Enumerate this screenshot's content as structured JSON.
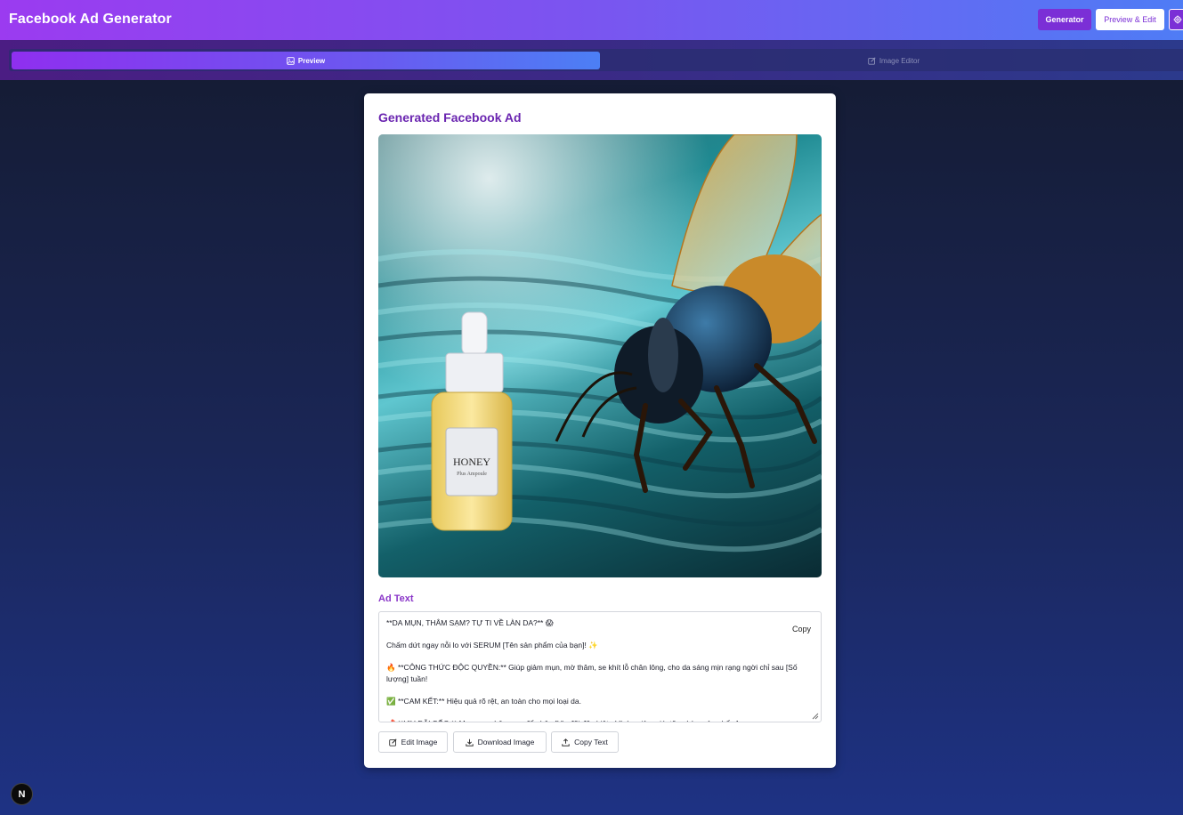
{
  "app": {
    "title": "Facebook Ad Generator"
  },
  "header": {
    "generator_label": "Generator",
    "preview_edit_label": "Preview & Edit",
    "settings_icon": "gear-icon"
  },
  "tabs": [
    {
      "label": "Preview",
      "icon": "image-icon",
      "active": true
    },
    {
      "label": "Image Editor",
      "icon": "edit-icon",
      "active": false
    }
  ],
  "card": {
    "title": "Generated Facebook Ad",
    "image_product_label": "HONEY",
    "image_product_sublabel": "Plus Ampoule",
    "ad_text_label": "Ad Text",
    "copy_label": "Copy",
    "ad_text": "**DA MỤN, THÂM SẠM? TỰ TI VỀ LÀN DA?** 😱\n\nChấm dứt ngay nỗi lo với SERUM [Tên sản phẩm của bạn]! ✨\n\n🔥 **CÔNG THỨC ĐỘC QUYỀN:** Giúp giảm mụn, mờ thâm, se khít lỗ chân lông, cho da sáng mịn rạng ngời chỉ sau [Số lượng] tuần!\n\n✅ **CAM KẾT:** Hiệu quả rõ rệt, an toàn cho mọi loại da.\n\n📌 **ƯU ĐÃI SỐC:** Mua ngay hôm nay để nhận [Ưu đãi đặc biệt - Ví dụ: giảm giá, tặng kèm sản phẩm]"
  },
  "actions": {
    "edit_image": "Edit Image",
    "download_image": "Download Image",
    "copy_text": "Copy Text"
  },
  "badge": {
    "label": "N"
  },
  "colors": {
    "accent": "#7b2fd6",
    "title": "#6a25b0",
    "header_start": "#9b3bf0",
    "header_end": "#4f7cf5"
  }
}
